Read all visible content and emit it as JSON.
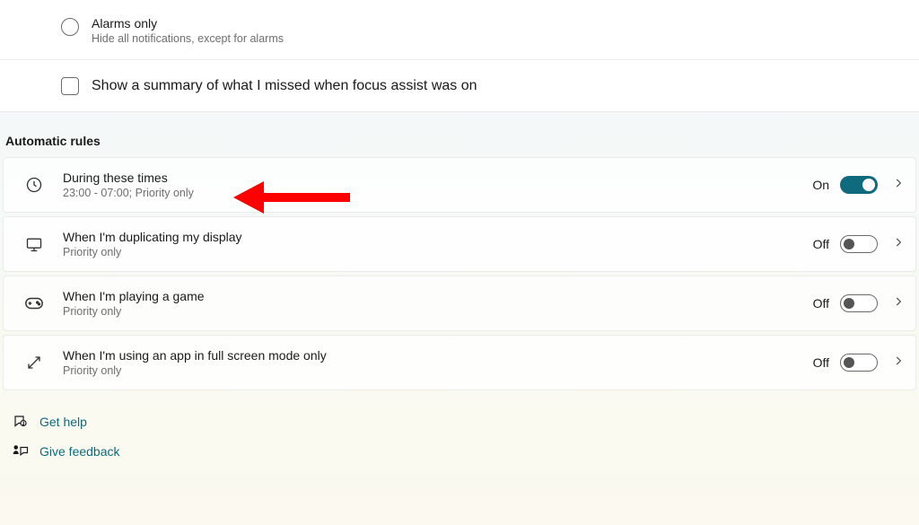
{
  "radio_option": {
    "title": "Alarms only",
    "subtitle": "Hide all notifications, except for alarms"
  },
  "summary_checkbox": {
    "label": "Show a summary of what I missed when focus assist was on"
  },
  "section_header": "Automatic rules",
  "rules": [
    {
      "title": "During these times",
      "subtitle": "23:00 - 07:00; Priority only",
      "state_label": "On",
      "state": "on"
    },
    {
      "title": "When I'm duplicating my display",
      "subtitle": "Priority only",
      "state_label": "Off",
      "state": "off"
    },
    {
      "title": "When I'm playing a game",
      "subtitle": "Priority only",
      "state_label": "Off",
      "state": "off"
    },
    {
      "title": "When I'm using an app in full screen mode only",
      "subtitle": "Priority only",
      "state_label": "Off",
      "state": "off"
    }
  ],
  "help": {
    "get_help": "Get help",
    "give_feedback": "Give feedback"
  }
}
